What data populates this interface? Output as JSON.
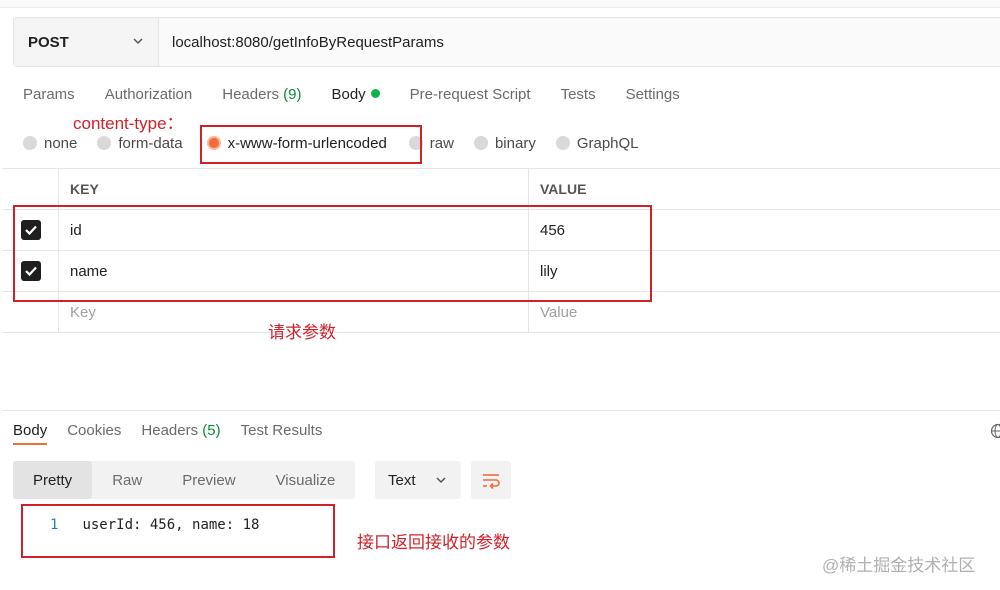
{
  "request": {
    "method": "POST",
    "url": "localhost:8080/getInfoByRequestParams"
  },
  "request_tabs": [
    {
      "label": "Params",
      "count": ""
    },
    {
      "label": "Authorization",
      "count": ""
    },
    {
      "label": "Headers ",
      "count": "(9)"
    },
    {
      "label": "Body",
      "count": ""
    },
    {
      "label": "Pre-request Script",
      "count": ""
    },
    {
      "label": "Tests",
      "count": ""
    },
    {
      "label": "Settings",
      "count": ""
    }
  ],
  "body_types": [
    "none",
    "form-data",
    "x-www-form-urlencoded",
    "raw",
    "binary",
    "GraphQL"
  ],
  "selected_body_type": "x-www-form-urlencoded",
  "params_table": {
    "headers": {
      "key": "KEY",
      "value": "VALUE"
    },
    "rows": [
      {
        "key": "id",
        "value": "456",
        "checked": true
      },
      {
        "key": "name",
        "value": "lily",
        "checked": true
      }
    ],
    "placeholder": {
      "key": "Key",
      "value": "Value"
    }
  },
  "annotations": {
    "content_type": "content-type：",
    "request_params": "请求参数",
    "response_params": "接口返回接收的参数"
  },
  "response_tabs": [
    {
      "label": "Body",
      "count": ""
    },
    {
      "label": "Cookies",
      "count": ""
    },
    {
      "label": "Headers ",
      "count": "(5)"
    },
    {
      "label": "Test Results",
      "count": ""
    }
  ],
  "view_modes": [
    "Pretty",
    "Raw",
    "Preview",
    "Visualize"
  ],
  "format": "Text",
  "response_body": {
    "line_number": "1",
    "content": "userId: 456, name: 18"
  },
  "watermark": "@稀土掘金技术社区",
  "colors": {
    "accent": "#f26b3a",
    "annotation": "#d0212a",
    "success": "#10b34b"
  }
}
